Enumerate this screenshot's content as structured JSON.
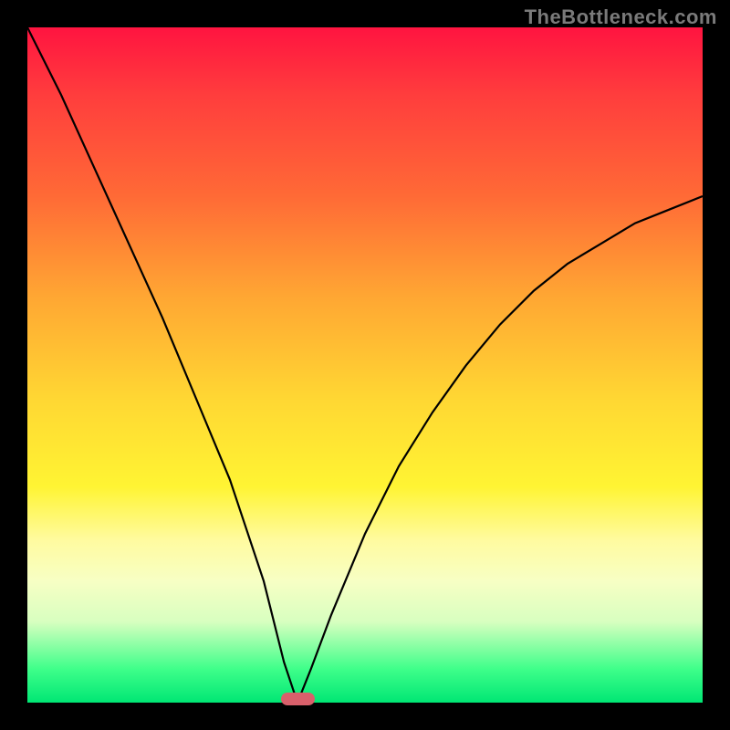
{
  "watermark": "TheBottleneck.com",
  "chart_data": {
    "type": "line",
    "title": "",
    "xlabel": "",
    "ylabel": "",
    "xlim": [
      0,
      100
    ],
    "ylim": [
      0,
      100
    ],
    "grid": false,
    "legend": false,
    "series": [
      {
        "name": "bottleneck-curve",
        "x": [
          0,
          5,
          10,
          15,
          20,
          25,
          30,
          35,
          38,
          40,
          42,
          45,
          50,
          55,
          60,
          65,
          70,
          75,
          80,
          85,
          90,
          95,
          100
        ],
        "y": [
          100,
          90,
          79,
          68,
          57,
          45,
          33,
          18,
          6,
          0,
          5,
          13,
          25,
          35,
          43,
          50,
          56,
          61,
          65,
          68,
          71,
          73,
          75
        ]
      }
    ],
    "marker": {
      "x_center": 40,
      "width": 5,
      "y": 0,
      "color": "#d9606b"
    },
    "background_gradient": {
      "top": "#ff1440",
      "mid": "#ffd733",
      "bottom": "#00e674"
    }
  },
  "plot": {
    "inner_left": 30,
    "inner_top": 30,
    "inner_width": 740,
    "inner_height": 740
  }
}
